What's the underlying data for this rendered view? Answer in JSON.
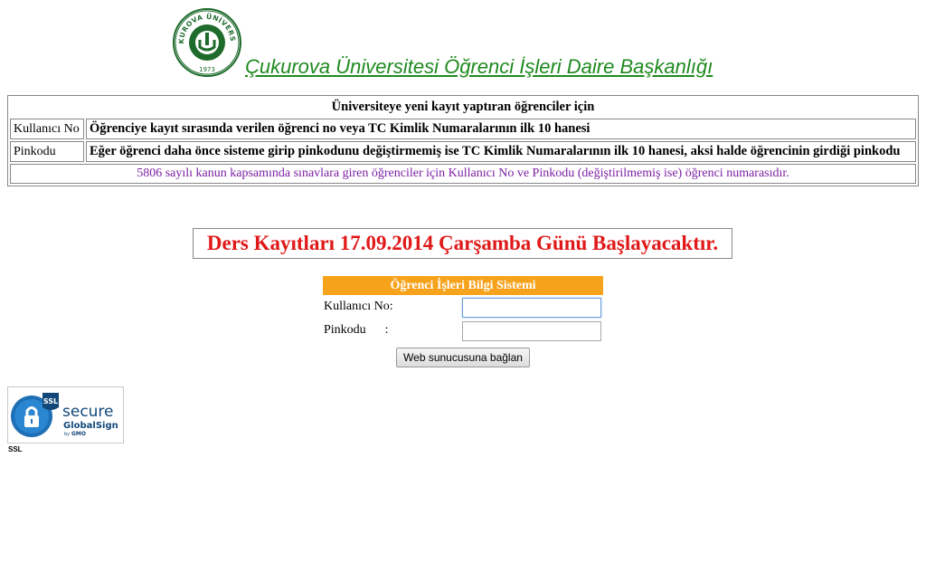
{
  "header": {
    "title": "Çukurova Üniversitesi Öğrenci İşleri Daire Başkanlığı",
    "logo": {
      "ring_text": "ÇUKUROVA ÜNİVERSİTY",
      "year": "1973"
    }
  },
  "info_table": {
    "heading": "Üniversiteye yeni kayıt yaptıran öğrenciler için",
    "rows": [
      {
        "label": "Kullanıcı No",
        "description": "Öğrenciye kayıt sırasında verilen öğrenci no veya TC Kimlik Numaralarının ilk 10 hanesi"
      },
      {
        "label": "Pinkodu",
        "description": "Eğer öğrenci daha önce sisteme girip pinkodunu değiştirmemiş ise TC Kimlik Numaralarının ilk 10 hanesi, aksi halde öğrencinin girdiği pinkodu"
      }
    ],
    "note": "5806 sayılı kanun kapsamında sınavlara giren öğrenciler için Kullanıcı No ve Pinkodu (değiştirilmemiş ise) öğrenci numarasıdır."
  },
  "announcement": "Ders Kayıtları 17.09.2014 Çarşamba Günü Başlayacaktır.",
  "login": {
    "header": "Öğrenci İşleri Bilgi Sistemi",
    "user_label": "Kullanıcı No:",
    "pin_label": "Pinkodu      :",
    "user_value": "",
    "pin_value": "",
    "submit_label": "Web sunucusuna bağlan"
  },
  "ssl": {
    "badge_tag": "SSL",
    "badge_title": "secure",
    "badge_brand": "GlobalSign",
    "badge_by": "by",
    "badge_vendor": "GMO",
    "caption": "SSL"
  },
  "colors": {
    "title_green": "#1f8a1f",
    "announcement_red": "#e01818",
    "login_header_orange": "#f7a21b",
    "note_purple": "#7a1fa2"
  }
}
